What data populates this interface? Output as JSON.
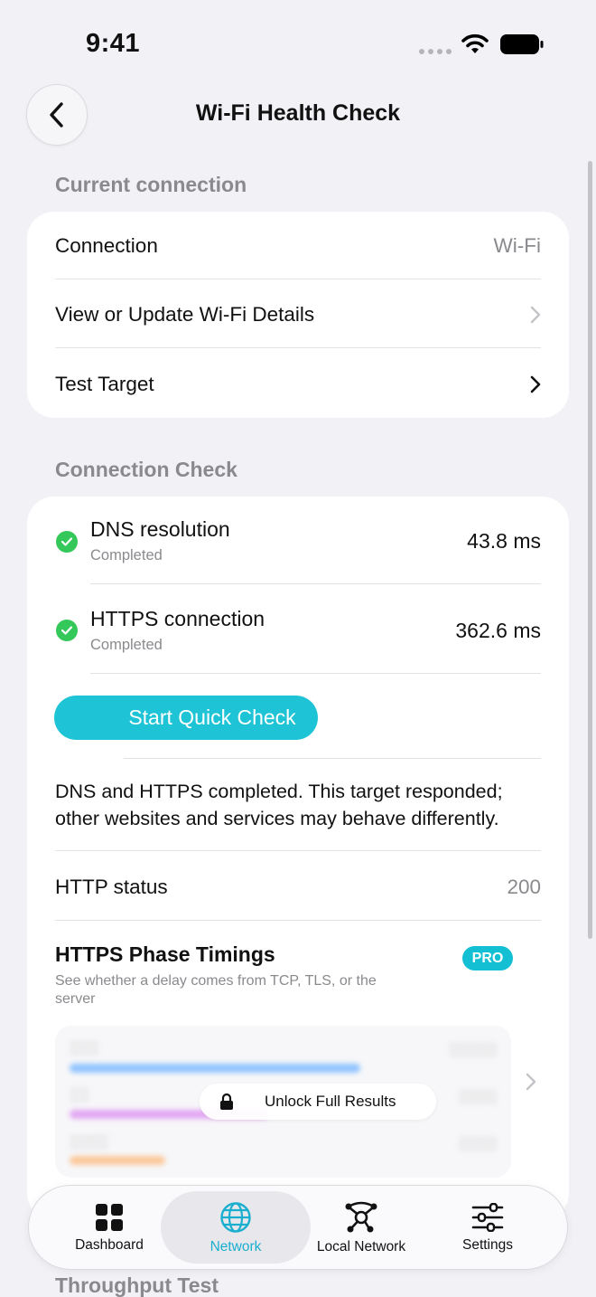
{
  "status_bar": {
    "time": "9:41"
  },
  "nav": {
    "title": "Wi-Fi Health Check"
  },
  "current_connection": {
    "header": "Current connection",
    "rows": [
      {
        "label": "Connection",
        "value": "Wi-Fi"
      },
      {
        "label": "View or Update Wi-Fi Details"
      },
      {
        "label": "Test Target"
      }
    ]
  },
  "connection_check": {
    "header": "Connection Check",
    "items": [
      {
        "title": "DNS resolution",
        "status": "Completed",
        "time": "43.8 ms"
      },
      {
        "title": "HTTPS connection",
        "status": "Completed",
        "time": "362.6 ms"
      }
    ],
    "button_label": "Start Quick Check",
    "summary": "DNS and HTTPS completed. This target responded; other websites and services may behave differently.",
    "http_status": {
      "label": "HTTP status",
      "value": "200"
    },
    "timings": {
      "title": "HTTPS Phase Timings",
      "badge": "PRO",
      "subtitle": "See whether a delay comes from TCP, TLS, or the server",
      "unlock_label": "Unlock Full Results"
    }
  },
  "next_section": {
    "header": "Throughput Test"
  },
  "tabs": [
    {
      "label": "Dashboard",
      "icon": "grid-icon"
    },
    {
      "label": "Network",
      "icon": "globe-icon"
    },
    {
      "label": "Local Network",
      "icon": "network-nodes-icon"
    },
    {
      "label": "Settings",
      "icon": "sliders-icon"
    }
  ],
  "active_tab": "Network",
  "colors": {
    "accent": "#1ec4d6",
    "success": "#34c759",
    "background": "#f2f2f6"
  }
}
